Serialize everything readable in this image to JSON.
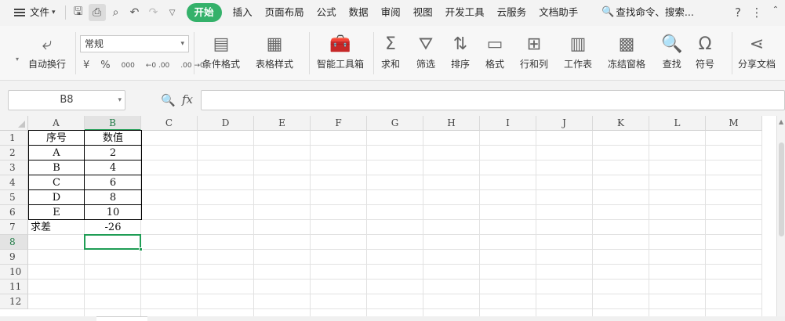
{
  "menu": {
    "file_label": "文件",
    "tabs": [
      "开始",
      "插入",
      "页面布局",
      "公式",
      "数据",
      "审阅",
      "视图",
      "开发工具",
      "云服务",
      "文档助手"
    ],
    "search_label": "查找命令、搜索..."
  },
  "ribbon": {
    "wrap_label": "自动换行",
    "number_format": "常规",
    "number_symbols": [
      "¥",
      "%",
      "000",
      "←0 .00",
      ".00 →0"
    ],
    "buttons": [
      "条件格式",
      "表格样式",
      "智能工具箱",
      "求和",
      "筛选",
      "排序",
      "格式",
      "行和列",
      "工作表",
      "冻结窗格",
      "查找",
      "符号",
      "分享文档"
    ]
  },
  "formula_bar": {
    "name_box": "B8",
    "fx_label": "fx",
    "formula": ""
  },
  "sheet": {
    "columns": [
      "A",
      "B",
      "C",
      "D",
      "E",
      "F",
      "G",
      "H",
      "I",
      "J",
      "K",
      "L",
      "M"
    ],
    "rows": [
      "1",
      "2",
      "3",
      "4",
      "5",
      "6",
      "7",
      "8",
      "9",
      "10",
      "11",
      "12"
    ],
    "active_cell": "B8",
    "cells": {
      "A1": "序号",
      "B1": "数值",
      "A2": "A",
      "B2": "2",
      "A3": "B",
      "B3": "4",
      "A4": "C",
      "B4": "6",
      "A5": "D",
      "B5": "8",
      "A6": "E",
      "B6": "10",
      "A7": "求差",
      "B7": "-26"
    }
  },
  "colors": {
    "accent": "#1f9d55",
    "start_tab": "#34b16a"
  }
}
